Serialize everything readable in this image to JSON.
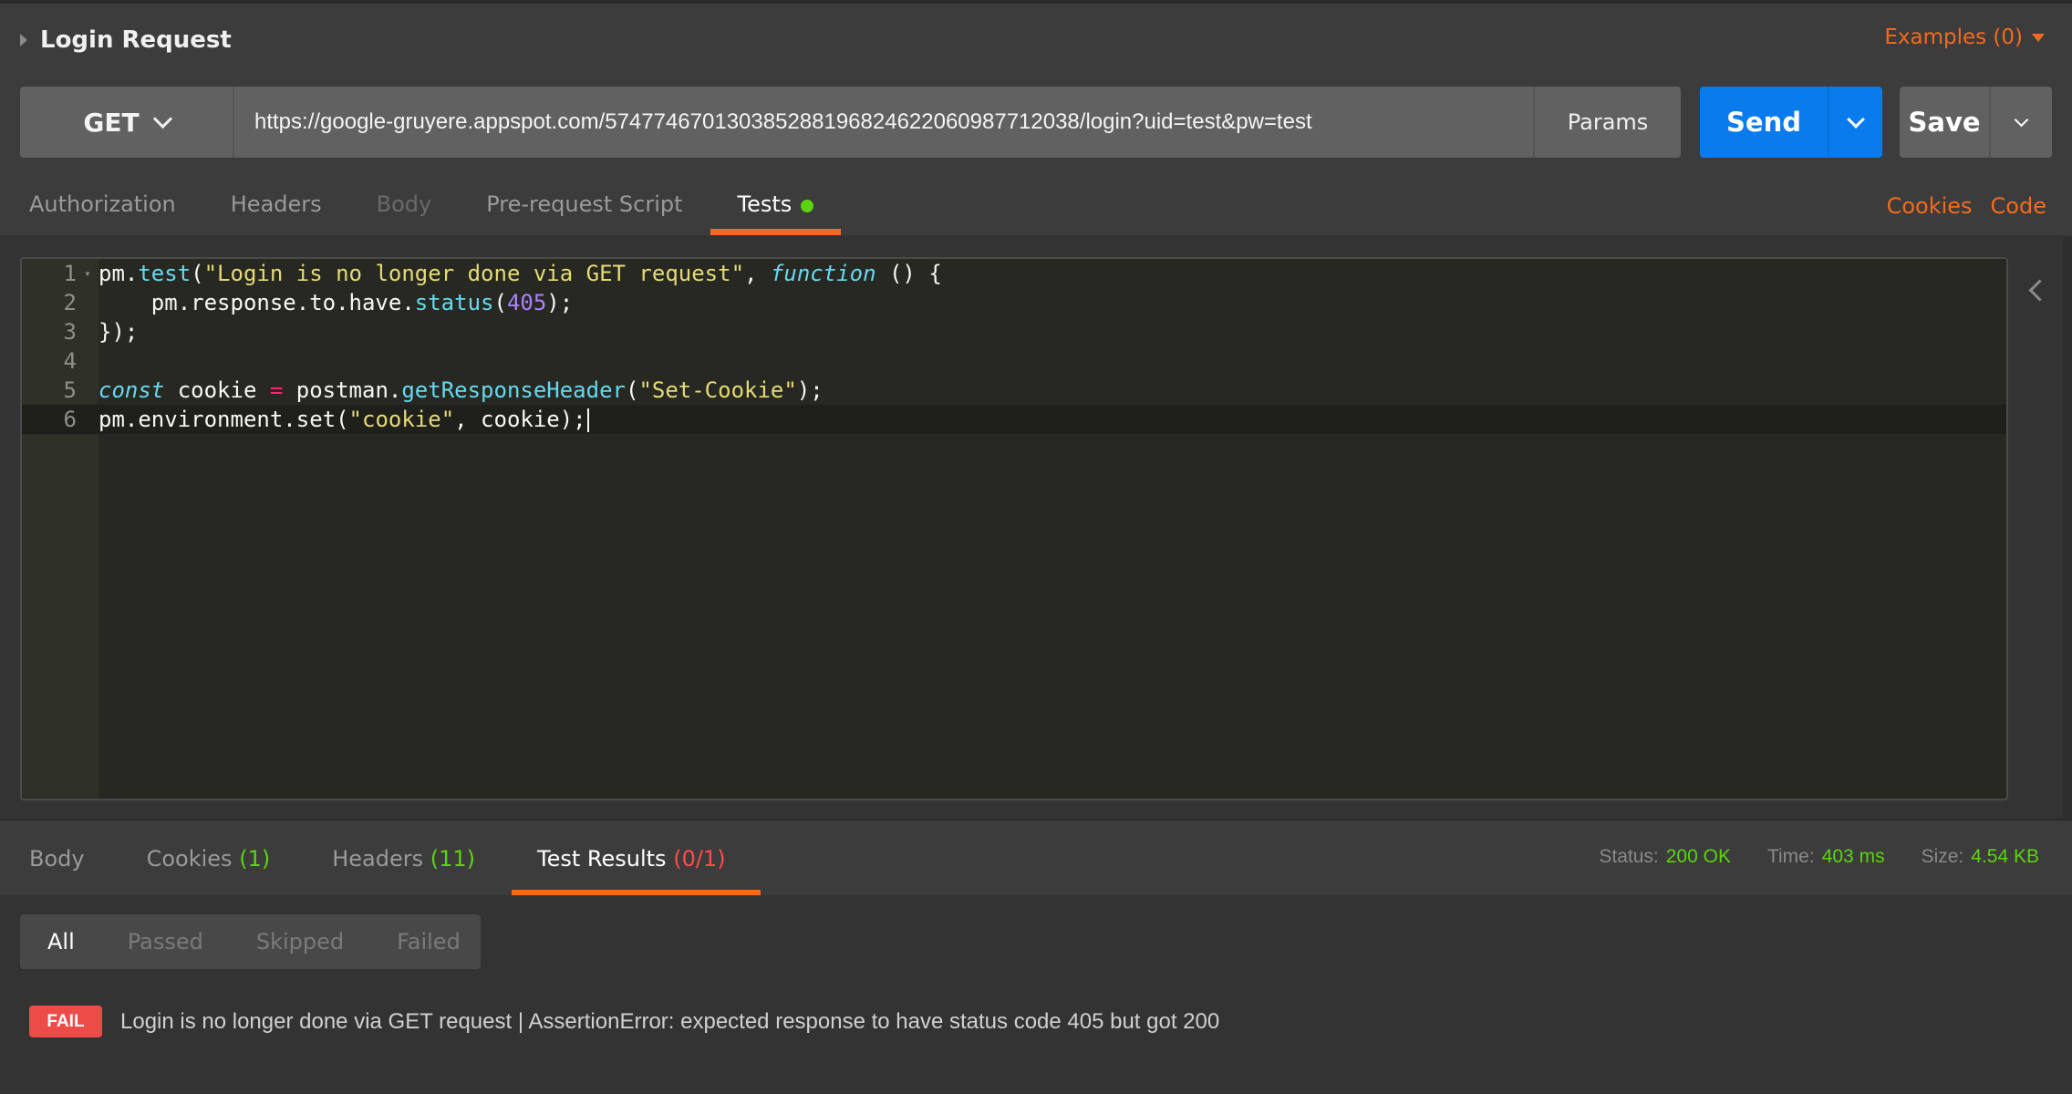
{
  "request": {
    "title": "Login Request",
    "examples_label": "Examples (0)",
    "method": "GET",
    "url": "https://google-gruyere.appspot.com/574774670130385288196824622060987712038/login?uid=test&pw=test",
    "params_label": "Params",
    "send_label": "Send",
    "save_label": "Save"
  },
  "request_tabs": [
    {
      "label": "Authorization",
      "state": "normal"
    },
    {
      "label": "Headers",
      "state": "normal"
    },
    {
      "label": "Body",
      "state": "disabled"
    },
    {
      "label": "Pre-request Script",
      "state": "normal"
    },
    {
      "label": "Tests",
      "state": "active",
      "indicator": "green-dot"
    }
  ],
  "links": {
    "cookies": "Cookies",
    "code": "Code"
  },
  "editor": {
    "lines": [
      {
        "n": "1",
        "tokens": [
          [
            "p",
            "pm."
          ],
          [
            "fn",
            "test"
          ],
          [
            "p",
            "("
          ],
          [
            "str",
            "\"Login is no longer done via GET request\""
          ],
          [
            "p",
            ", "
          ],
          [
            "kw",
            "function"
          ],
          [
            "p",
            " () {"
          ]
        ],
        "fold": true
      },
      {
        "n": "2",
        "tokens": [
          [
            "p",
            "    pm.response.to.have."
          ],
          [
            "fn",
            "status"
          ],
          [
            "p",
            "("
          ],
          [
            "num",
            "405"
          ],
          [
            "p",
            ");"
          ]
        ]
      },
      {
        "n": "3",
        "tokens": [
          [
            "p",
            "});"
          ]
        ]
      },
      {
        "n": "4",
        "tokens": []
      },
      {
        "n": "5",
        "tokens": [
          [
            "kw",
            "const"
          ],
          [
            "p",
            " cookie "
          ],
          [
            "op",
            "="
          ],
          [
            "p",
            " postman."
          ],
          [
            "fn",
            "getResponseHeader"
          ],
          [
            "p",
            "("
          ],
          [
            "str",
            "\"Set-Cookie\""
          ],
          [
            "p",
            ");"
          ]
        ]
      },
      {
        "n": "6",
        "tokens": [
          [
            "p",
            "pm.environment.set("
          ],
          [
            "str",
            "\"cookie\""
          ],
          [
            "p",
            ", cookie);"
          ]
        ],
        "active": true
      }
    ]
  },
  "response_tabs": [
    {
      "label": "Body",
      "count": ""
    },
    {
      "label": "Cookies",
      "count": "(1)",
      "count_color": "green"
    },
    {
      "label": "Headers",
      "count": "(11)",
      "count_color": "green"
    },
    {
      "label": "Test Results",
      "count": "(0/1)",
      "count_color": "red",
      "active": true
    }
  ],
  "response_meta": {
    "status_label": "Status:",
    "status": "200 OK",
    "time_label": "Time:",
    "time": "403 ms",
    "size_label": "Size:",
    "size": "4.54 KB"
  },
  "filters": [
    "All",
    "Passed",
    "Skipped",
    "Failed"
  ],
  "active_filter": "All",
  "results": [
    {
      "badge": "FAIL",
      "message": "Login is no longer done via GET request | AssertionError: expected response to have status code 405 but got 200"
    }
  ],
  "colors": {
    "accent": "#f26b1d",
    "send": "#097bed",
    "pass": "#5bd40f",
    "fail": "#ed4b48"
  }
}
